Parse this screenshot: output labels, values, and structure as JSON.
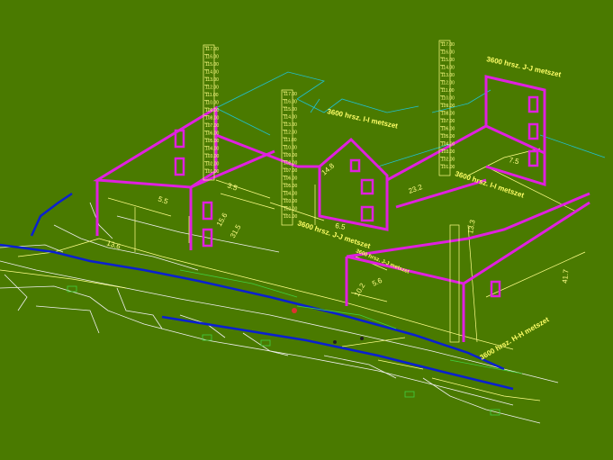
{
  "colors": {
    "background": "#4a7a00",
    "section_outline": "#e020e0",
    "dimension": "#ffff88",
    "road": "#0a20d0",
    "cyan_line": "#20c0d0",
    "white_line": "#f0f0f0",
    "green_line": "#40d040",
    "marker": "#e03030"
  },
  "section_labels": {
    "ii": "3600 hrsz. I-I metszet",
    "jj_upper": "3600 hrsz. J-J metszet",
    "jj_lower": "3600 hrsz. J-J metszet",
    "ii_lower": "3600 hrsz. I-I metszet",
    "jj_side": "3600 hrsz. J-J metszet",
    "hh": "3600 hrsz. H-H metszet"
  },
  "dimensions": {
    "d1": "5.5",
    "d2": "3.5",
    "d3": "15.6",
    "d4": "14.8",
    "d5": "6.5",
    "d6": "13.6",
    "d7": "23.2",
    "d8": "13.3",
    "d9": "7.5",
    "d10": "10.2",
    "d11": "5.6",
    "d12": "41.7",
    "d13": "31.5"
  },
  "scale_left": [
    "117.00",
    "116.00",
    "115.00",
    "114.00",
    "113.00",
    "112.00",
    "111.00",
    "110.00",
    "109.00",
    "108.00",
    "107.00",
    "106.00",
    "105.00",
    "104.00",
    "103.00",
    "102.00",
    "101.00"
  ],
  "scale_mid": [
    "117.00",
    "116.00",
    "115.00",
    "114.00",
    "113.00",
    "112.00",
    "111.00",
    "110.00",
    "109.00",
    "108.00",
    "107.00",
    "106.00",
    "105.00",
    "104.00",
    "103.00",
    "102.00",
    "101.00"
  ],
  "scale_right": [
    "117.00",
    "116.00",
    "115.00",
    "114.00",
    "113.00",
    "112.00",
    "111.00",
    "110.00",
    "109.00",
    "108.00",
    "107.00",
    "106.00",
    "105.00",
    "104.00",
    "103.00",
    "102.00",
    "101.00"
  ]
}
